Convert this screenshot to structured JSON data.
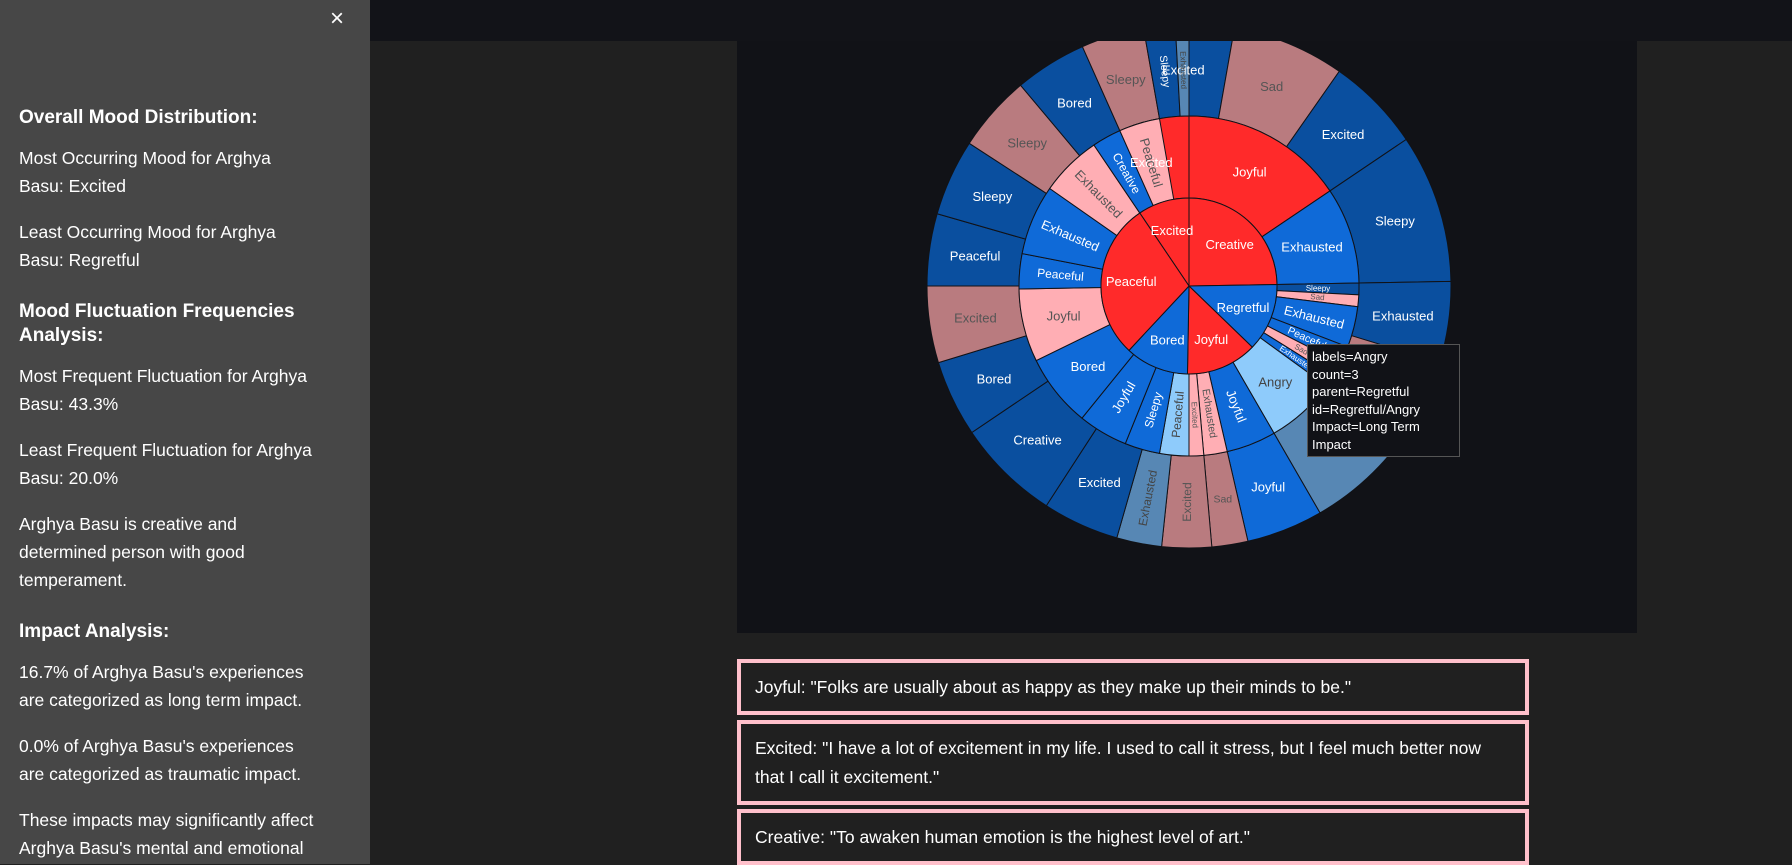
{
  "sidebar": {
    "close_label": "×",
    "overall_heading": "Overall Mood Distribution:",
    "most_mood": "Most Occurring Mood for Arghya Basu: Excited",
    "least_mood": "Least Occurring Mood for Arghya Basu: Regretful",
    "fluct_heading": "Mood Fluctuation Frequencies Analysis:",
    "most_fluct": "Most Frequent Fluctuation for Arghya Basu: 43.3%",
    "least_fluct": "Least Frequent Fluctuation for Arghya Basu: 20.0%",
    "summary": "Arghya Basu is creative and determined person with good temperament.",
    "impact_heading": "Impact Analysis:",
    "long_term": "16.7% of Arghya Basu's experiences are categorized as long term impact.",
    "traumatic": "0.0% of Arghya Basu's experiences are categorized as traumatic impact.",
    "affect": "These impacts may significantly affect Arghya Basu's mental and emotional well-"
  },
  "colors": {
    "red": "#ff2a2a",
    "pink": "#ffaeb4",
    "dusty_rose": "#b97b7f",
    "blue": "#0f6ad8",
    "dark_blue": "#0a4f9f",
    "light_blue": "#8ecbfb",
    "steel_blue": "#5787b4",
    "panel": "#111217",
    "quote_border": "#ffc0cb"
  },
  "chart_data": {
    "type": "sunburst",
    "inner": [
      {
        "label": "Excited",
        "color": "red"
      },
      {
        "label": "Creative",
        "color": "red"
      },
      {
        "label": "Regretful",
        "color": "blue"
      },
      {
        "label": "Joyful",
        "color": "red"
      },
      {
        "label": "Bored",
        "color": "blue"
      },
      {
        "label": "Peaceful",
        "color": "red"
      }
    ],
    "middle": [
      {
        "label": "Excited",
        "color": "red"
      },
      {
        "label": "Joyful",
        "color": "red"
      },
      {
        "label": "Exhausted",
        "color": "blue"
      },
      {
        "label": "Sleepy",
        "color": "dark_blue"
      },
      {
        "label": "Sad",
        "color": "pink"
      },
      {
        "label": "Exhausted",
        "color": "blue"
      },
      {
        "label": "Peaceful",
        "color": "blue"
      },
      {
        "label": "Sad",
        "color": "pink"
      },
      {
        "label": "Exhausted",
        "color": "blue"
      },
      {
        "label": "Angry",
        "color": "light_blue"
      },
      {
        "label": "Joyful",
        "color": "blue"
      },
      {
        "label": "Exhausted",
        "color": "pink"
      },
      {
        "label": "Excited",
        "color": "pink"
      },
      {
        "label": "Peaceful",
        "color": "light_blue"
      },
      {
        "label": "Sleepy",
        "color": "blue"
      },
      {
        "label": "Joyful",
        "color": "blue"
      },
      {
        "label": "Bored",
        "color": "blue"
      },
      {
        "label": "Joyful",
        "color": "pink"
      },
      {
        "label": "Peaceful",
        "color": "blue"
      },
      {
        "label": "Exhausted",
        "color": "blue"
      },
      {
        "label": "Exhausted",
        "color": "pink"
      },
      {
        "label": "Creative",
        "color": "blue"
      },
      {
        "label": "Peaceful",
        "color": "pink"
      }
    ],
    "outer": [
      {
        "label": "Excited",
        "color": "dark_blue"
      },
      {
        "label": "Sad",
        "color": "dusty_rose"
      },
      {
        "label": "Excited",
        "color": "dark_blue"
      },
      {
        "label": "Sleepy",
        "color": "dark_blue"
      },
      {
        "label": "Exhausted",
        "color": "dark_blue"
      },
      {
        "label": "",
        "color": "dusty_rose"
      },
      {
        "label": "Sad",
        "color": "steel_blue"
      },
      {
        "label": "Joyful",
        "color": "blue"
      },
      {
        "label": "Sad",
        "color": "dusty_rose"
      },
      {
        "label": "Excited",
        "color": "dusty_rose"
      },
      {
        "label": "Exhausted",
        "color": "steel_blue"
      },
      {
        "label": "Excited",
        "color": "dark_blue"
      },
      {
        "label": "Creative",
        "color": "dark_blue"
      },
      {
        "label": "Bored",
        "color": "dark_blue"
      },
      {
        "label": "Excited",
        "color": "dusty_rose"
      },
      {
        "label": "Peaceful",
        "color": "dark_blue"
      },
      {
        "label": "Sleepy",
        "color": "dark_blue"
      },
      {
        "label": "Sleepy",
        "color": "dusty_rose"
      },
      {
        "label": "Bored",
        "color": "dark_blue"
      },
      {
        "label": "Sleepy",
        "color": "dusty_rose"
      },
      {
        "label": "Sleepy",
        "color": "dark_blue"
      },
      {
        "label": "Exhausted",
        "color": "steel_blue"
      }
    ],
    "tooltip": {
      "lines": [
        "labels=Angry",
        "count=3",
        "parent=Regretful",
        "id=Regretful/Angry",
        "Impact=Long Term Impact"
      ]
    }
  },
  "quotes": [
    "Joyful: \"Folks are usually about as happy as they make up their minds to be.\"",
    "Excited: \"I have a lot of excitement in my life. I used to call it stress, but I feel much better now that I call it excitement.\"",
    "Creative: \"To awaken human emotion is the highest level of art.\""
  ]
}
